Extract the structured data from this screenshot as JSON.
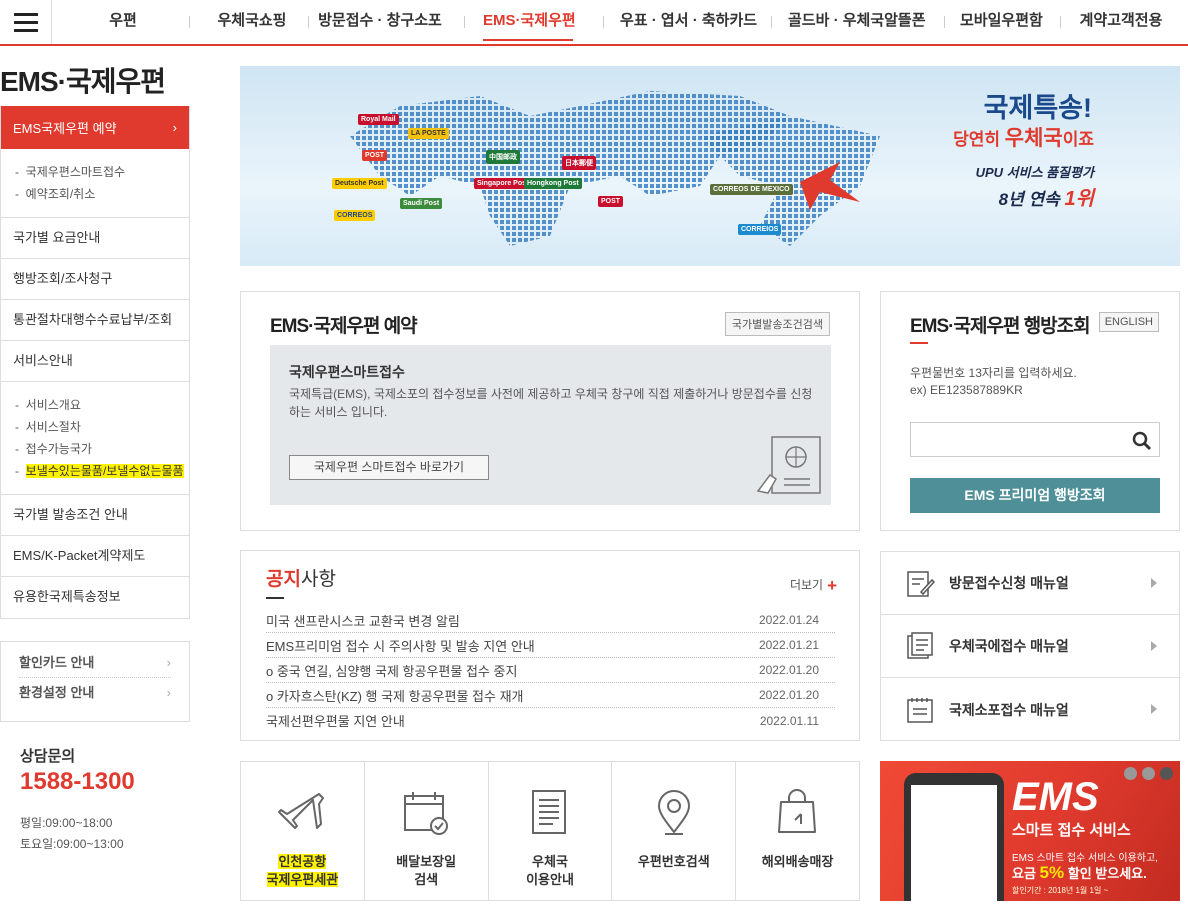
{
  "nav": {
    "items": [
      "우편",
      "우체국쇼핑",
      "방문접수 · 창구소포",
      "EMS·국제우편",
      "우표 · 엽서 · 축하카드",
      "골드바 · 우체국알뜰폰",
      "모바일우편함",
      "계약고객전용"
    ],
    "active_index": 3
  },
  "sidebar": {
    "page_title": "EMS·국제우편",
    "active_item": "EMS국제우편 예약",
    "active_sub": [
      "국제우편스마트접수",
      "예약조회/취소"
    ],
    "items": [
      "국가별 요금안내",
      "행방조회/조사청구",
      "통관절차대행수수료납부/조회",
      "서비스안내"
    ],
    "service_sub": [
      "서비스개요",
      "서비스절차",
      "접수가능국가",
      "보낼수있는물품/보낼수없는물품"
    ],
    "items2": [
      "국가별 발송조건 안내",
      "EMS/K-Packet계약제도",
      "유용한국제특송정보"
    ],
    "links": [
      "할인카드 안내",
      "환경설정 안내"
    ],
    "cs_title": "상담문의",
    "cs_phone": "1588-1300",
    "cs_weekday": "평일:09:00~18:00",
    "cs_saturday": "토요일:09:00~13:00"
  },
  "banner": {
    "line1": "국제특송!",
    "line2_pre": "당연히 ",
    "line2_bold": "우체국",
    "line2_post": "이죠",
    "line3": "UPU 서비스 품질평가",
    "line4_pre": "8년 연속 ",
    "line4_bold": "1위",
    "flags": [
      "Royal Mail",
      "LA POSTE",
      "POST",
      "Deutsche Post",
      "CORREOS",
      "Saudi Post",
      "中国邮政",
      "日本郵便",
      "POST",
      "CORREOS DE MEXICO",
      "CORREIOS",
      "Singapore Post",
      "Hongkong Post"
    ]
  },
  "reservation": {
    "title": "EMS·국제우편 예약",
    "cond_button": "국가별발송조건검색",
    "box_title": "국제우편스마트접수",
    "box_desc": "국제특급(EMS), 국제소포의 접수정보를 사전에 제공하고 우체국 창구에 직접 제출하거나 방문접수를 신청하는 서비스 입니다.",
    "go_button": "국제우편 스마트접수 바로가기"
  },
  "tracking": {
    "title": "EMS·국제우편 행방조회",
    "english_button": "ENGLISH",
    "desc1": "우편물번호 13자리를 입력하세요.",
    "desc2": "ex) EE123587889KR",
    "input_value": "",
    "premium_button": "EMS 프리미엄 행방조회"
  },
  "notice": {
    "title_red": "공지",
    "title_rest": "사항",
    "more": "더보기",
    "rows": [
      {
        "title": "미국 샌프란시스코 교환국 변경 알림",
        "date": "2022.01.24"
      },
      {
        "title": "EMS프리미엄 접수 시 주의사항 및 발송 지연 안내",
        "date": "2022.01.21"
      },
      {
        "title": "o 중국 연길, 심양행 국제 항공우편물 접수 중지",
        "date": "2022.01.20"
      },
      {
        "title": "o 카자흐스탄(KZ) 행 국제 항공우편물 접수 재개",
        "date": "2022.01.20"
      },
      {
        "title": "국제선편우편물 지연 안내",
        "date": "2022.01.11"
      }
    ]
  },
  "manuals": [
    "방문접수신청 매뉴얼",
    "우체국에접수 매뉴얼",
    "국제소포접수 매뉴얼"
  ],
  "quick": [
    {
      "l1": "인천공항",
      "l2": "국제우편세관",
      "icon": "airplane-icon"
    },
    {
      "l1": "배달보장일",
      "l2": "검색",
      "icon": "calendar-check-icon"
    },
    {
      "l1": "우체국",
      "l2": "이용안내",
      "icon": "document-icon"
    },
    {
      "l1": "우편번호검색",
      "l2": "",
      "icon": "location-pin-icon"
    },
    {
      "l1": "해외배송매장",
      "l2": "",
      "icon": "shopping-bag-icon"
    }
  ],
  "ad": {
    "title": "EMS",
    "subtitle": "스마트 접수 서비스",
    "line1": "EMS 스마트 접수 서비스 이용하고,",
    "line2_pre": "요금 ",
    "line2_bold": "5%",
    "line2_post": " 할인 받으세요.",
    "line3": "할인기간 : 2018년 1월 1일 ~"
  },
  "colors": {
    "accent": "#e03a2e",
    "teal": "#4f8f98",
    "highlight": "#fff200"
  }
}
